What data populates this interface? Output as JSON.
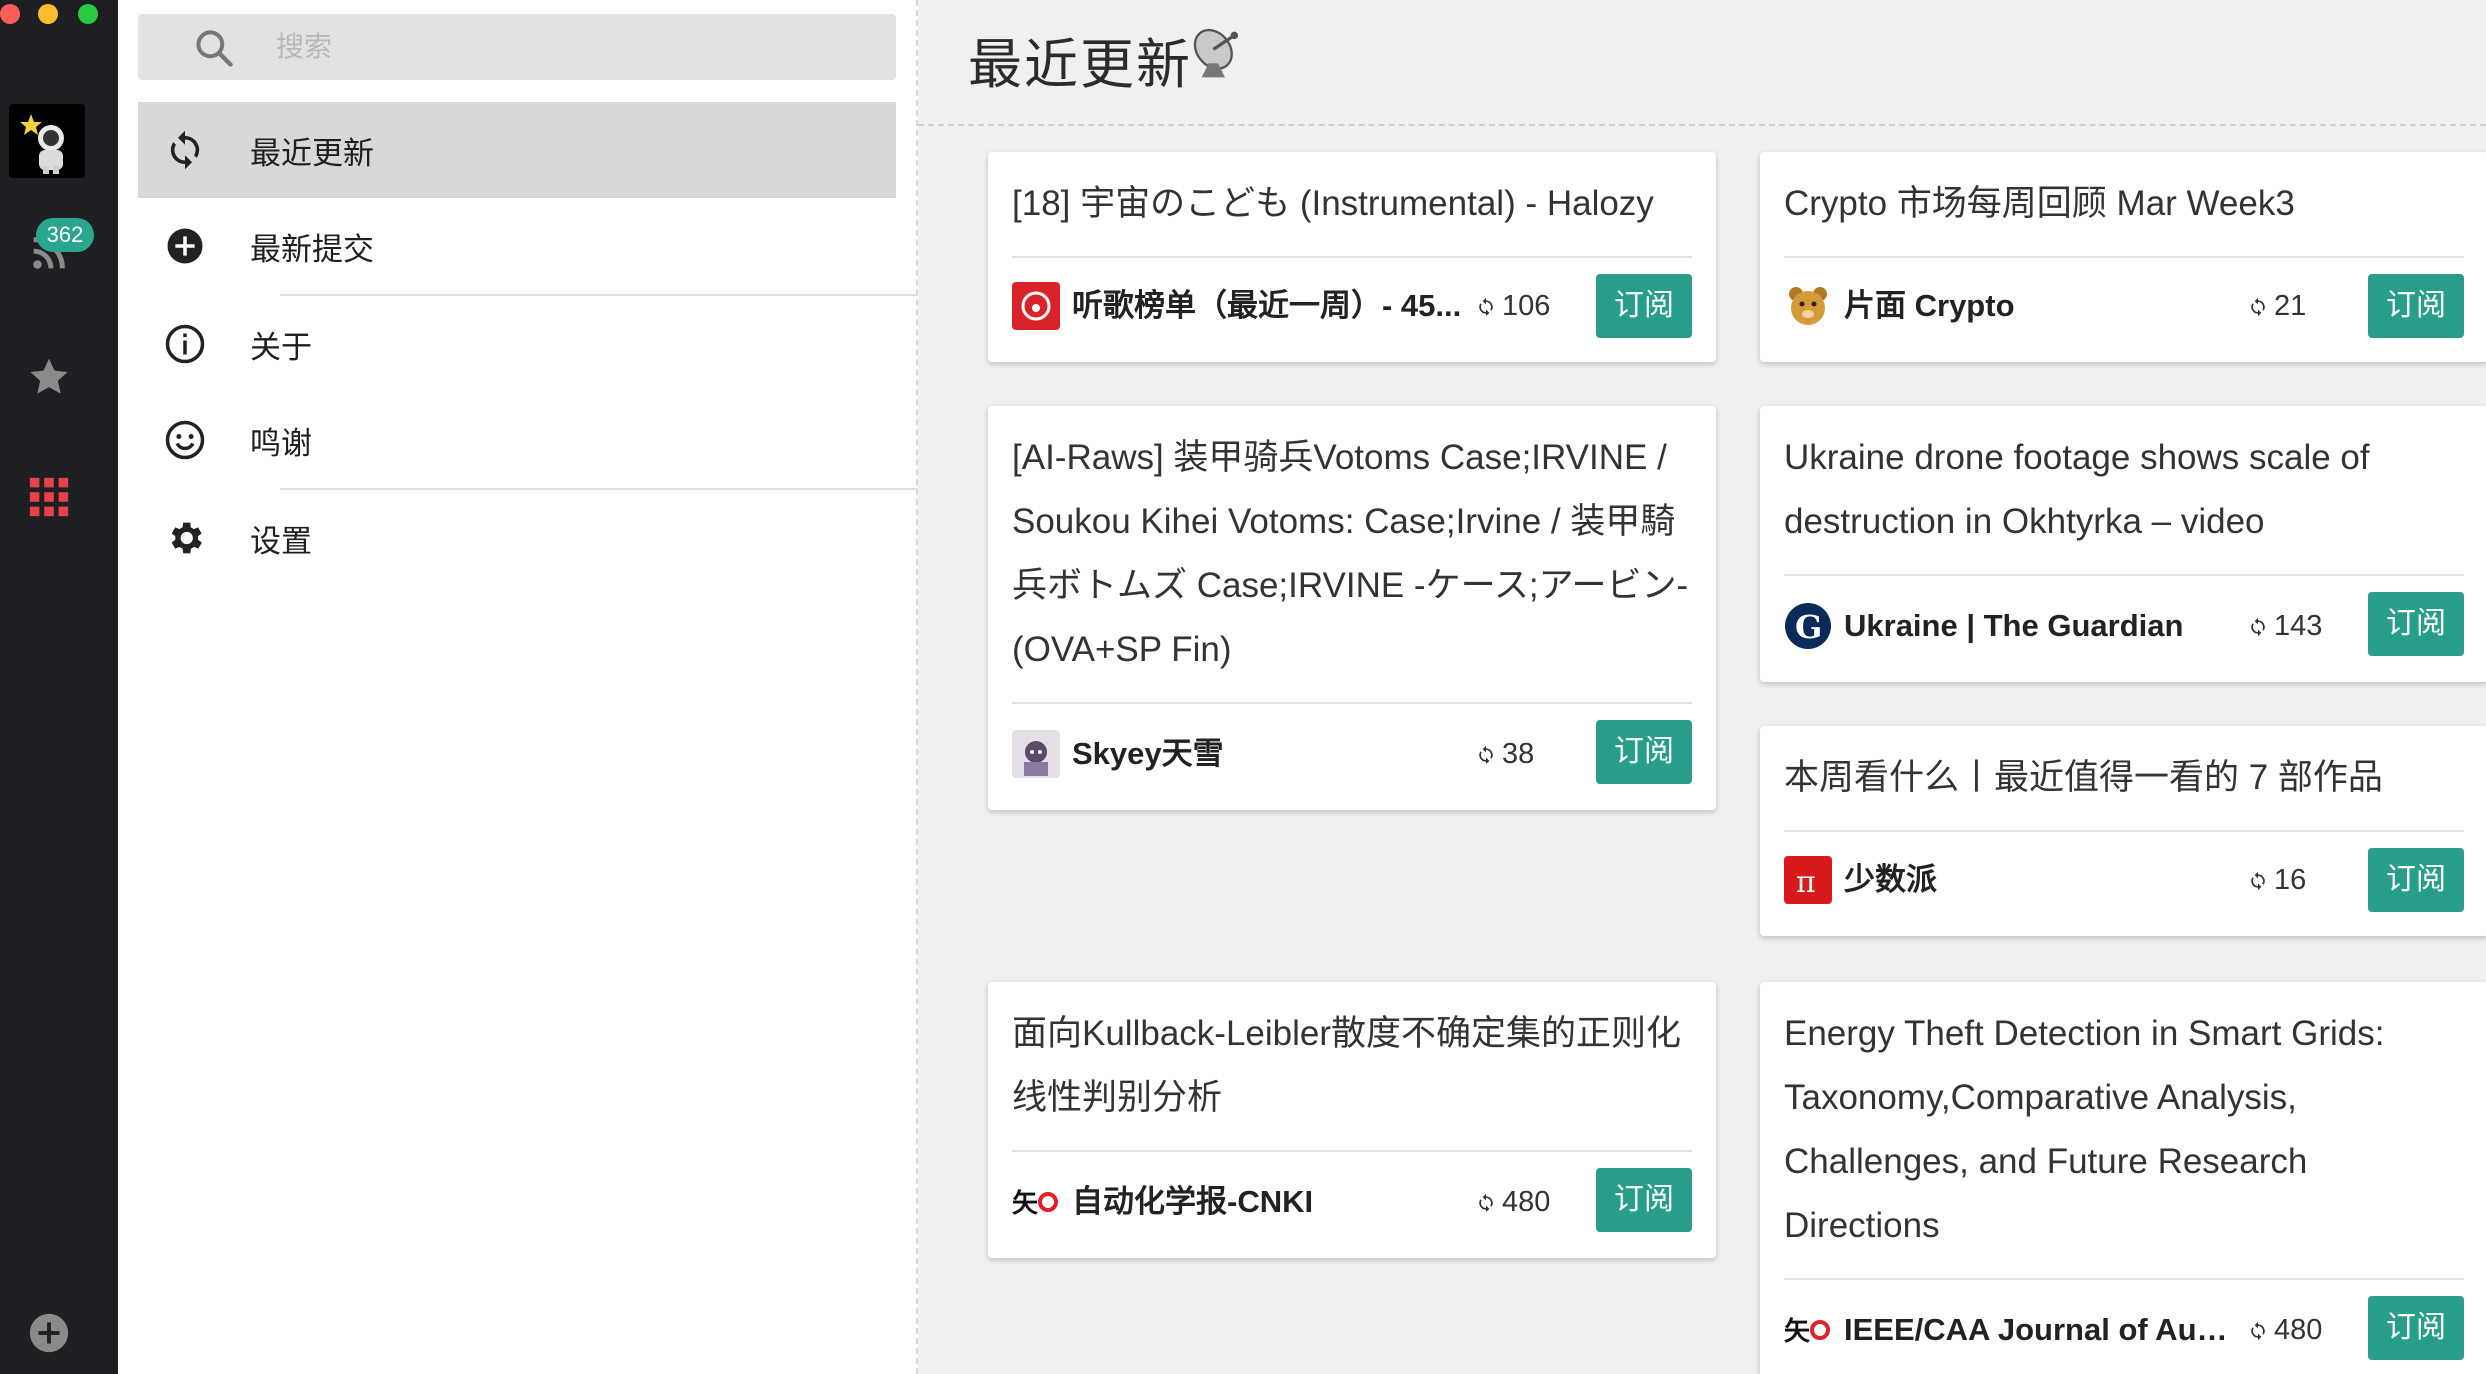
{
  "rail": {
    "badge_count": "362"
  },
  "search": {
    "placeholder": "搜索"
  },
  "nav": {
    "items": [
      {
        "label": "最近更新",
        "icon": "sync-icon",
        "active": true
      },
      {
        "label": "最新提交",
        "icon": "add-circle-icon"
      },
      {
        "label": "关于",
        "icon": "info-icon"
      },
      {
        "label": "鸣谢",
        "icon": "smile-icon"
      },
      {
        "label": "设置",
        "icon": "gear-icon"
      }
    ]
  },
  "main": {
    "title": "最近更新",
    "title_emoji": "satellite-dish-icon",
    "subscribe_label": "订阅"
  },
  "cards": [
    {
      "title": "[18] 宇宙のこども (Instrumental) - Halozy",
      "feed": "听歌榜单（最近一周）- 45...",
      "logo": "netease-music-icon",
      "count": "106"
    },
    {
      "title": "[AI-Raws] 装甲骑兵Votoms Case;IRVINE / Soukou Kihei Votoms: Case;Irvine / 装甲騎兵ボトムズ Case;IRVINE -ケース;アービン- (OVA+SP Fin)",
      "feed": "Skyey天雪",
      "logo": "anime-avatar-icon",
      "count": "38"
    },
    {
      "title": "面向Kullback-Leibler散度不确定集的正则化线性判别分析",
      "feed": "自动化学报-CNKI",
      "logo": "cnki-icon",
      "count": "480"
    },
    {
      "title": "Crypto 市场每周回顾 Mar Week3",
      "feed": "片面 Crypto",
      "logo": "bear-icon",
      "count": "21"
    },
    {
      "title": "Ukraine drone footage shows scale of destruction in Okhtyrka – video",
      "feed": "Ukraine | The Guardian",
      "logo": "guardian-icon",
      "count": "143"
    },
    {
      "title": "本周看什么丨最近值得一看的 7 部作品",
      "feed": "少数派",
      "logo": "sspai-icon",
      "count": "16"
    },
    {
      "title": "Energy Theft Detection in Smart Grids: Taxonomy,Comparative Analysis, Challenges, and Future Research Directions",
      "feed": "IEEE/CAA Journal of Auto...",
      "logo": "cnki-icon",
      "count": "480"
    }
  ],
  "colors": {
    "rail_bg": "#1e1f22",
    "accent": "#279d8a",
    "badge": "#2aa58e",
    "rail_apps": "#e8414b"
  }
}
